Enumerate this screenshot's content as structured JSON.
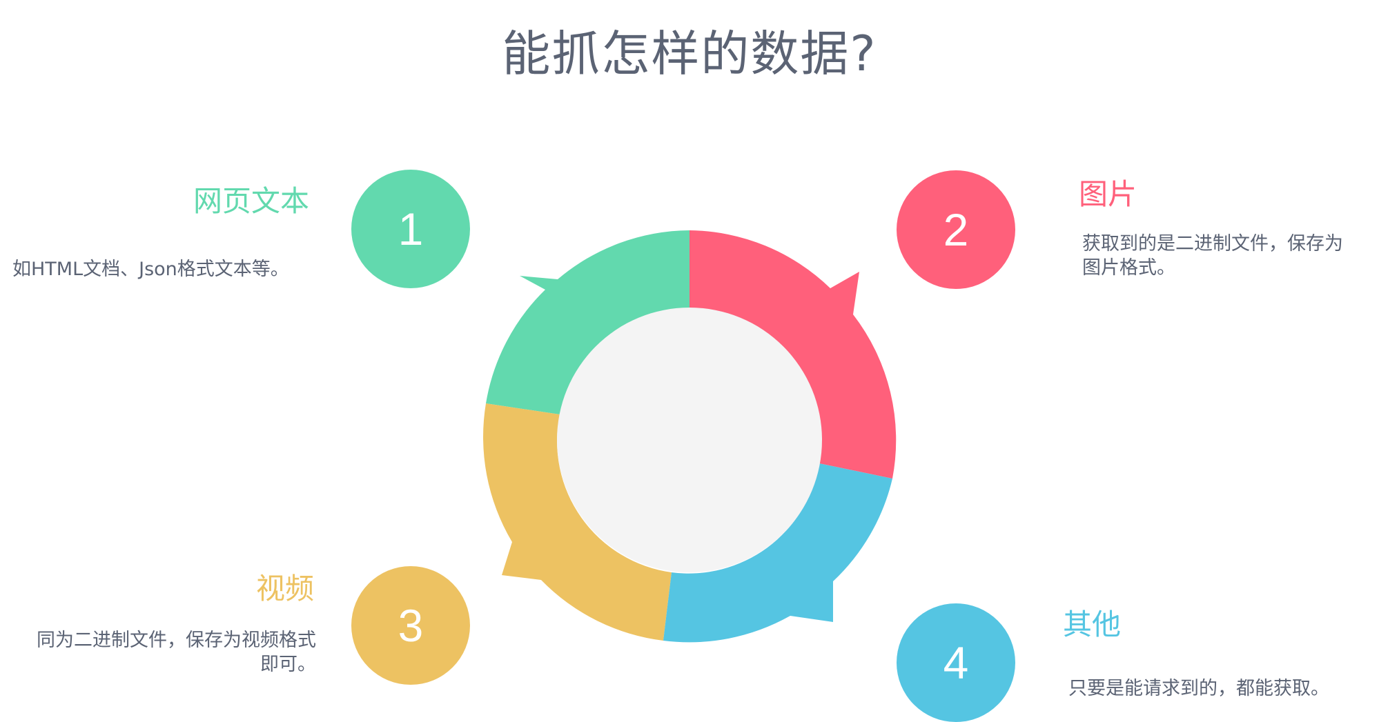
{
  "title": "能抓怎样的数据?",
  "colors": {
    "green": "#62d9ae",
    "red": "#ff607b",
    "yellow": "#edc262",
    "blue": "#55c5e2",
    "center": "#f4f4f4",
    "text": "#5b6374"
  },
  "items": [
    {
      "number": "1",
      "title": "网页文本",
      "desc": "如HTML文档、Json格式文本等。"
    },
    {
      "number": "2",
      "title": "图片",
      "desc_lines": [
        "获取到的是二进制文件，保存为",
        "图片格式。"
      ]
    },
    {
      "number": "3",
      "title": "视频",
      "desc_lines": [
        "同为二进制文件，保存为视频格式",
        "即可。"
      ]
    },
    {
      "number": "4",
      "title": "其他",
      "desc": "只要是能请求到的，都能获取。"
    }
  ]
}
